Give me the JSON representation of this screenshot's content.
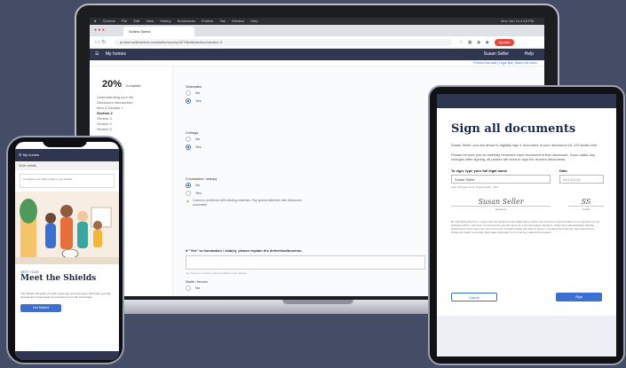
{
  "laptop": {
    "menubar": [
      "Chrome",
      "File",
      "Edit",
      "View",
      "History",
      "Bookmarks",
      "Profiles",
      "Tab",
      "Window",
      "Help"
    ],
    "menubar_clock": "Mon Jun 14  2:15 PM",
    "tab_title": "Sellers Select",
    "url": "protect.sellerselect.com/seller/survey/427/fields/section/section-3",
    "user_chip": "Update",
    "app_title": "My homes",
    "user_name": "Susan Seller",
    "help": "Help",
    "sub_links": "Preview this sale  |  Legal tips  |  Watch the video",
    "progress_pct": "20%",
    "progress_word": "Complete",
    "steps": [
      "Understanding your list",
      "Disclosure introduction",
      "Intro & Section 1",
      "Section 2",
      "Section 3",
      "Section 4",
      "Section 5"
    ],
    "active_step_index": 3,
    "q1": {
      "title": "Sidewalks",
      "options": [
        "No",
        "Yes"
      ],
      "selected": 1
    },
    "q2": {
      "title": "Ceilings",
      "options": [
        "No",
        "Yes"
      ],
      "selected": 1
    },
    "q3": {
      "title": "Foundation / slab(s)",
      "options": [
        "No",
        "Yes"
      ],
      "selected": 0
    },
    "warning": "Common problems with existing materials. Pay special attention with disclosure accurately.",
    "q4_title": "If \"Yes\" to foundation / slab(s), please explain the defect/malfunction.",
    "q4_hint": "e.g. There is a crack in the foundation in the garage.",
    "q5": {
      "title": "Walls / fences",
      "options": [
        "No",
        "Yes"
      ],
      "selected": -1
    }
  },
  "phone": {
    "nav": "My homes",
    "sub": "Seller details",
    "card_text": "Complete your seller profile to get started.",
    "eyebrow": "MEET YOUR",
    "title": "Meet the Shields",
    "body": "The Shields will guide you with expert tips and resources. We'll help you fully disclose the current state of your home so it's fair and simple.",
    "button": "Get Started"
  },
  "tablet": {
    "title": "Sign all documents",
    "intro": "Susan Seller, you are about to digitally sign 1 document of your disclosure for 123 Austin Ave.",
    "note": "Please be sure you've carefully reviewed each document in this disclosure. If you make any changes after signing, all parties will need to sign the revised documents.",
    "name_label": "To sign, type your full legal name",
    "date_label": "Date",
    "name_value": "Susan Seller",
    "date_value": "06/14/2021",
    "name_hint": "Your full legal name: Susan Seller  ·  Edit",
    "signature": "Susan Seller",
    "initials": "SS",
    "sig_caption": "Signature",
    "init_caption": "Initials",
    "legal": "By submitting this form, I agree that the signature and initials above will be the electronic representation of my signature for all purposes when I use them on documents, just the same as a pen-and-paper signature. Seller also acknowledges that the statements in this notice are true to the best of Seller's belief and that no person, including the broker(s), has instructed or influenced Seller to provide inaccurate information or to omit any material information.",
    "cancel": "Cancel",
    "sign": "Sign"
  },
  "colors": {
    "background": "#454c66",
    "app_navy": "#2f3650",
    "accent_blue": "#3b6fd0"
  }
}
